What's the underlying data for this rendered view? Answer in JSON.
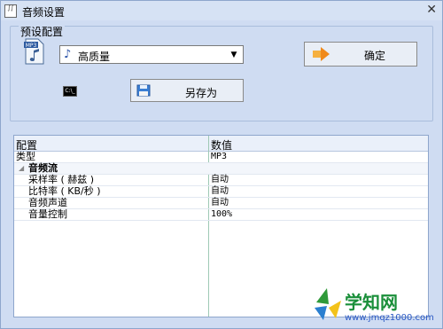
{
  "window": {
    "title": "音频设置"
  },
  "preset": {
    "group_label": "预设配置",
    "file_icon_text": "MP3",
    "selected": "高质量",
    "cmd_icon_text": "C:\\_"
  },
  "buttons": {
    "ok": "确定",
    "save_as": "另存为"
  },
  "grid": {
    "columns": [
      "配置",
      "数值"
    ],
    "rows": [
      {
        "key": "类型",
        "value": "MP3"
      },
      {
        "key": "音频流",
        "value": "",
        "category": true
      },
      {
        "key": "采样率 ( 赫兹 )",
        "value": "自动"
      },
      {
        "key": "比特率 ( KB/秒 )",
        "value": "自动"
      },
      {
        "key": "音频声道",
        "value": "自动"
      },
      {
        "key": "音量控制",
        "value": "100%"
      }
    ]
  },
  "watermark": {
    "title": "学知网",
    "url": "www.jmqz1000.com"
  },
  "colors": {
    "accent": "#2a53a8",
    "ok_arrow": "#f08a1c",
    "watermark_green": "#1a8f3a"
  }
}
